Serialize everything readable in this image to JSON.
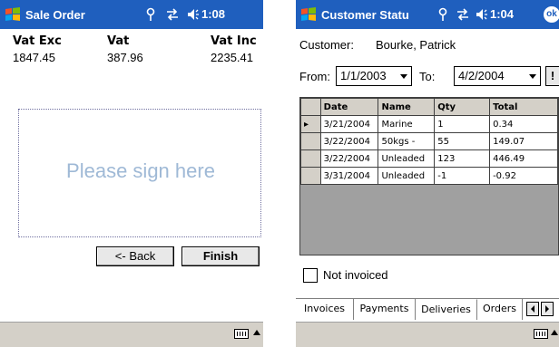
{
  "screenA": {
    "title": "Sale Order",
    "time": "1:08",
    "vat_exc_label": "Vat Exc",
    "vat_label": "Vat",
    "vat_inc_label": "Vat Inc",
    "vat_exc_value": "1847.45",
    "vat_value": "387.96",
    "vat_inc_value": "2235.41",
    "signature_placeholder": "Please sign here",
    "back_label": "<- Back",
    "finish_label": "Finish"
  },
  "screenB": {
    "title": "Customer Statu",
    "time": "1:04",
    "ok_label": "ok",
    "customer_label": "Customer:",
    "customer_name": "Bourke, Patrick",
    "from_label": "From:",
    "from_date": "1/1/2003",
    "to_label": "To:",
    "to_date": "4/2/2004",
    "go_label": "!",
    "columns": [
      "Date",
      "Name",
      "Qty",
      "Total"
    ],
    "rows": [
      [
        "3/21/2004",
        "Marine",
        "1",
        "0.34"
      ],
      [
        "3/22/2004",
        "50kgs -",
        "55",
        "149.07"
      ],
      [
        "3/22/2004",
        "Unleaded",
        "123",
        "446.49"
      ],
      [
        "3/31/2004",
        "Unleaded",
        "-1",
        "-0.92"
      ]
    ],
    "row_marker": "▸",
    "not_invoiced_label": "Not invoiced",
    "tabs": [
      "Invoices",
      "Payments",
      "Deliveries",
      "Orders"
    ],
    "active_tab": "Deliveries"
  },
  "colors": {
    "titlebar": "#1f5fbe",
    "taskbar": "#d4d0c8",
    "grid_empty": "#a0a0a0",
    "signature_text": "#9fb9d6"
  },
  "icons": [
    "windows-flag-icon",
    "antenna-icon",
    "sync-icon",
    "speaker-icon",
    "keyboard-icon",
    "caret-up-icon",
    "ok-icon",
    "tab-scroll-left-icon",
    "tab-scroll-right-icon"
  ]
}
